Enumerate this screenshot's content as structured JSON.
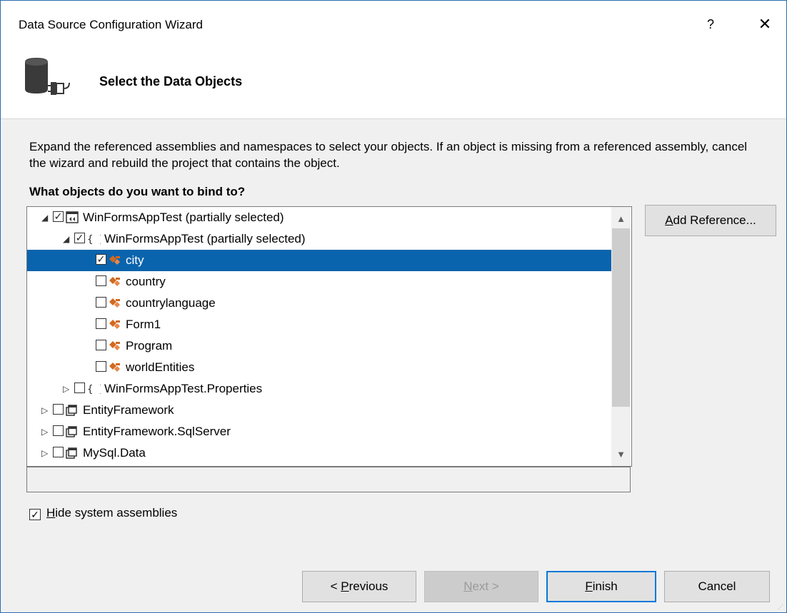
{
  "window": {
    "title": "Data Source Configuration Wizard",
    "help_glyph": "?",
    "close_glyph": "✕"
  },
  "header": {
    "title": "Select the Data Objects",
    "icon": "database-connection-icon"
  },
  "body": {
    "description": "Expand the referenced assemblies and namespaces to select your objects. If an object is missing from a referenced assembly, cancel the wizard and rebuild the project that contains the object.",
    "question": "What objects do you want to bind to?"
  },
  "tree": {
    "items": [
      {
        "label": "WinFormsAppTest (partially selected)",
        "checked": true,
        "expanded": true,
        "icon": "project-icon",
        "selected": false
      },
      {
        "label": "WinFormsAppTest (partially selected)",
        "checked": true,
        "expanded": true,
        "icon": "namespace-icon",
        "selected": false
      },
      {
        "label": "city",
        "checked": true,
        "icon": "class-icon",
        "selected": true
      },
      {
        "label": "country",
        "checked": false,
        "icon": "class-icon",
        "selected": false
      },
      {
        "label": "countrylanguage",
        "checked": false,
        "icon": "class-icon",
        "selected": false
      },
      {
        "label": "Form1",
        "checked": false,
        "icon": "class-icon",
        "selected": false
      },
      {
        "label": "Program",
        "checked": false,
        "icon": "class-icon",
        "selected": false
      },
      {
        "label": "worldEntities",
        "checked": false,
        "icon": "class-icon",
        "selected": false
      },
      {
        "label": "WinFormsAppTest.Properties",
        "checked": false,
        "expanded": false,
        "icon": "namespace-icon",
        "selected": false
      },
      {
        "label": "EntityFramework",
        "checked": false,
        "expanded": false,
        "icon": "assembly-icon",
        "selected": false
      },
      {
        "label": "EntityFramework.SqlServer",
        "checked": false,
        "expanded": false,
        "icon": "assembly-icon",
        "selected": false
      },
      {
        "label": "MySql.Data",
        "checked": false,
        "expanded": false,
        "icon": "assembly-icon",
        "selected": false
      }
    ]
  },
  "buttons": {
    "add_reference": {
      "mnemonic": "A",
      "rest": "dd Reference..."
    },
    "previous": {
      "prefix": "< ",
      "mnemonic": "P",
      "rest": "revious"
    },
    "next": {
      "mnemonic": "N",
      "rest": "ext >"
    },
    "finish": {
      "mnemonic": "F",
      "rest": "inish"
    },
    "cancel": "Cancel"
  },
  "options": {
    "hide_system_assemblies": {
      "mnemonic": "H",
      "rest": "ide system assemblies",
      "checked": true
    }
  },
  "colors": {
    "selection": "#0a64ad",
    "accent": "#0078d7",
    "class_icon": "#d2691e"
  }
}
